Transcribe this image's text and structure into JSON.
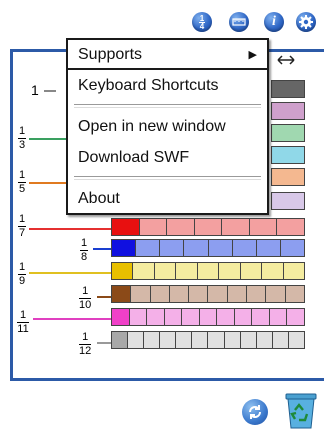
{
  "toolbar": {
    "quarter_icon_label": "1/4",
    "ruler_icon": "ruler-icon",
    "info_icon_label": "i",
    "settings_icon": "gear-icon"
  },
  "resize_icon": "double-arrow-icon",
  "fractions": [
    {
      "num": "1",
      "den": ""
    },
    {
      "num": "1",
      "den": "3"
    },
    {
      "num": "1",
      "den": "5"
    },
    {
      "num": "1",
      "den": "7"
    },
    {
      "num": "1",
      "den": "8"
    },
    {
      "num": "1",
      "den": "9"
    },
    {
      "num": "1",
      "den": "10"
    },
    {
      "num": "1",
      "den": "11"
    },
    {
      "num": "1",
      "den": "12"
    }
  ],
  "context_menu": {
    "supports": "Supports",
    "supports_arrow": "▶",
    "keyboard_shortcuts": "Keyboard Shortcuts",
    "open_new_window": "Open in new window",
    "download_swf": "Download SWF",
    "about": "About"
  },
  "colors": {
    "panel_border": "#2c5aa7",
    "red_lead": "#e53030",
    "blue_lead": "#1a3fd0",
    "yellow_lead": "#e0c020",
    "orange_lead": "#e07a20"
  },
  "bottom": {
    "refresh_icon": "refresh-icon",
    "trash_icon": "recycle-bin-icon"
  }
}
